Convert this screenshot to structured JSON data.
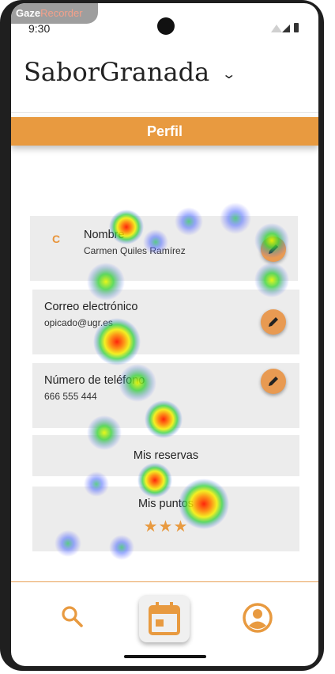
{
  "overlay": {
    "gaze_part1": "Gaze",
    "gaze_part2": "Recorder"
  },
  "status_bar": {
    "time": "9:30"
  },
  "app": {
    "title": "SaborGranada",
    "title_chevron": "⌄"
  },
  "header": {
    "title": "Perfil"
  },
  "profile": {
    "name_card": {
      "initial": "C",
      "label": "Nombre",
      "value": "Carmen Quiles Ramírez"
    },
    "email_card": {
      "label": "Correo electrónico",
      "value": "opicado@ugr.es"
    },
    "phone_card": {
      "label": "Número de teléfono",
      "value": "666 555 444"
    },
    "reservations_card": {
      "label": "Mis reservas"
    },
    "points_card": {
      "label": "Mis puntos",
      "stars": "★★★",
      "star_count": 3
    }
  },
  "bottom_nav": {
    "items": [
      {
        "icon": "search-icon",
        "selected": false
      },
      {
        "icon": "calendar-icon",
        "selected": true
      },
      {
        "icon": "account-icon",
        "selected": false
      }
    ]
  },
  "colors": {
    "accent": "#e89a40",
    "card_background": "#ececec",
    "edit_button": "#e89a52"
  }
}
